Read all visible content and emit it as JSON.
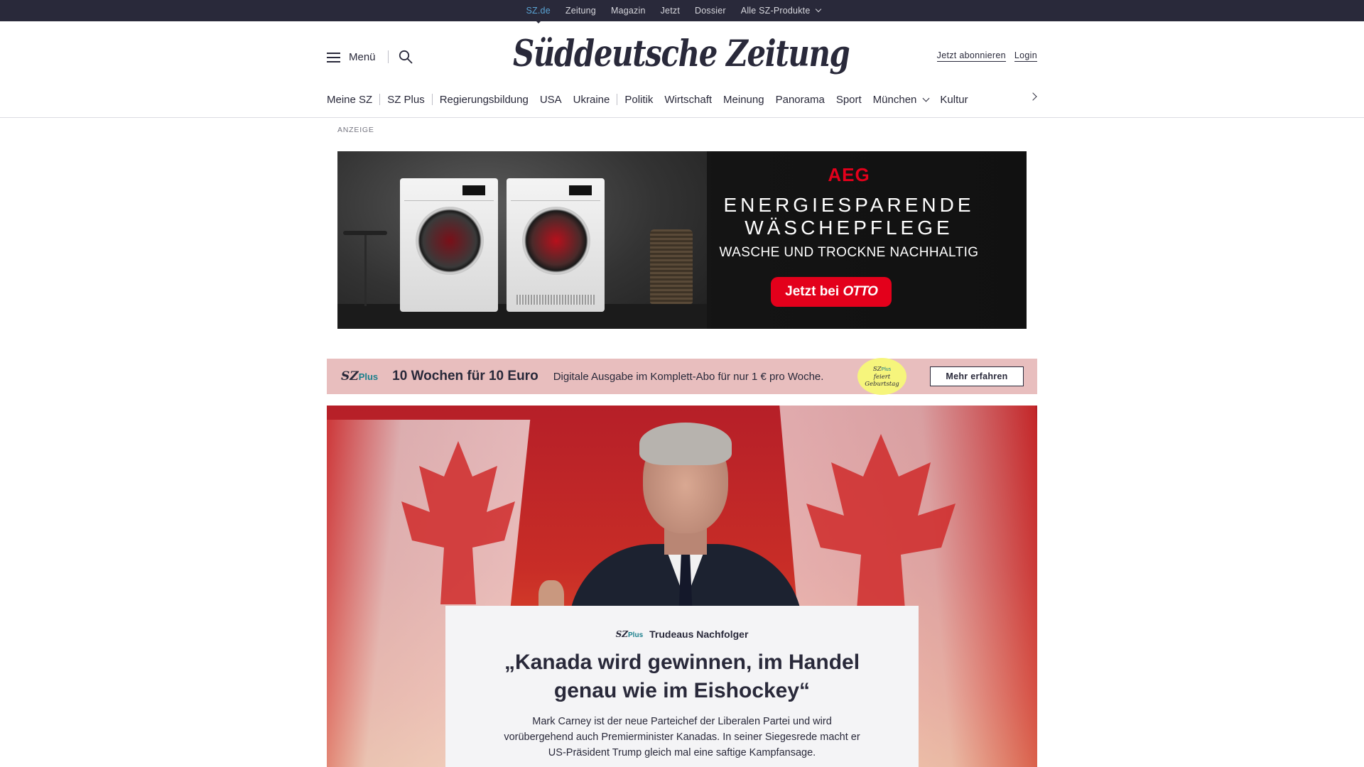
{
  "topbar": {
    "items": [
      "SZ.de",
      "Zeitung",
      "Magazin",
      "Jetzt",
      "Dossier",
      "Alle SZ-Produkte"
    ]
  },
  "header": {
    "menu_label": "Menü",
    "logo_text": "Süddeutsche Zeitung",
    "subscribe_label": "Jetzt abonnieren",
    "login_label": "Login"
  },
  "nav": {
    "items": [
      "Meine SZ",
      "SZ Plus",
      "Regierungsbildung",
      "USA",
      "Ukraine",
      "Politik",
      "Wirtschaft",
      "Meinung",
      "Panorama",
      "Sport",
      "München",
      "Kultur"
    ]
  },
  "ad": {
    "label": "ANZEIGE",
    "brand": "AEG",
    "headline_line1": "ENERGIESPARENDE",
    "headline_line2": "WÄSCHEPFLEGE",
    "subline": "WASCHE UND TROCKNE NACHHALTIG",
    "cta_prefix": "Jetzt bei",
    "cta_brand": "OTTO"
  },
  "promo": {
    "logo_sz": "SZ",
    "logo_plus": "Plus",
    "headline": "10 Wochen für 10 Euro",
    "description": "Digitale Ausgabe im Komplett-Abo für nur 1 € pro Woche.",
    "badge_line1": "SZ",
    "badge_plus": "Plus",
    "badge_line2": "feiert",
    "badge_line3": "Geburtstag",
    "button_label": "Mehr erfahren"
  },
  "hero": {
    "kicker_sz": "SZ",
    "kicker_plus": "Plus",
    "kicker_label": "Trudeaus Nachfolger",
    "headline": "„Kanada wird gewinnen, im Handel genau wie im Eishockey“",
    "teaser": "Mark Carney ist der neue Parteichef der Liberalen Partei und wird vorübergehend auch Premierminister Kanadas. In seiner Siegesrede macht er US-Präsident Trump gleich mal eine saftige Kampfansage."
  },
  "colors": {
    "brand_dark": "#29293a",
    "topbar_active": "#5aa4d6",
    "sz_plus_teal": "#1a7f8c",
    "promo_bg": "#e8bebe",
    "ad_red": "#e3001b"
  }
}
